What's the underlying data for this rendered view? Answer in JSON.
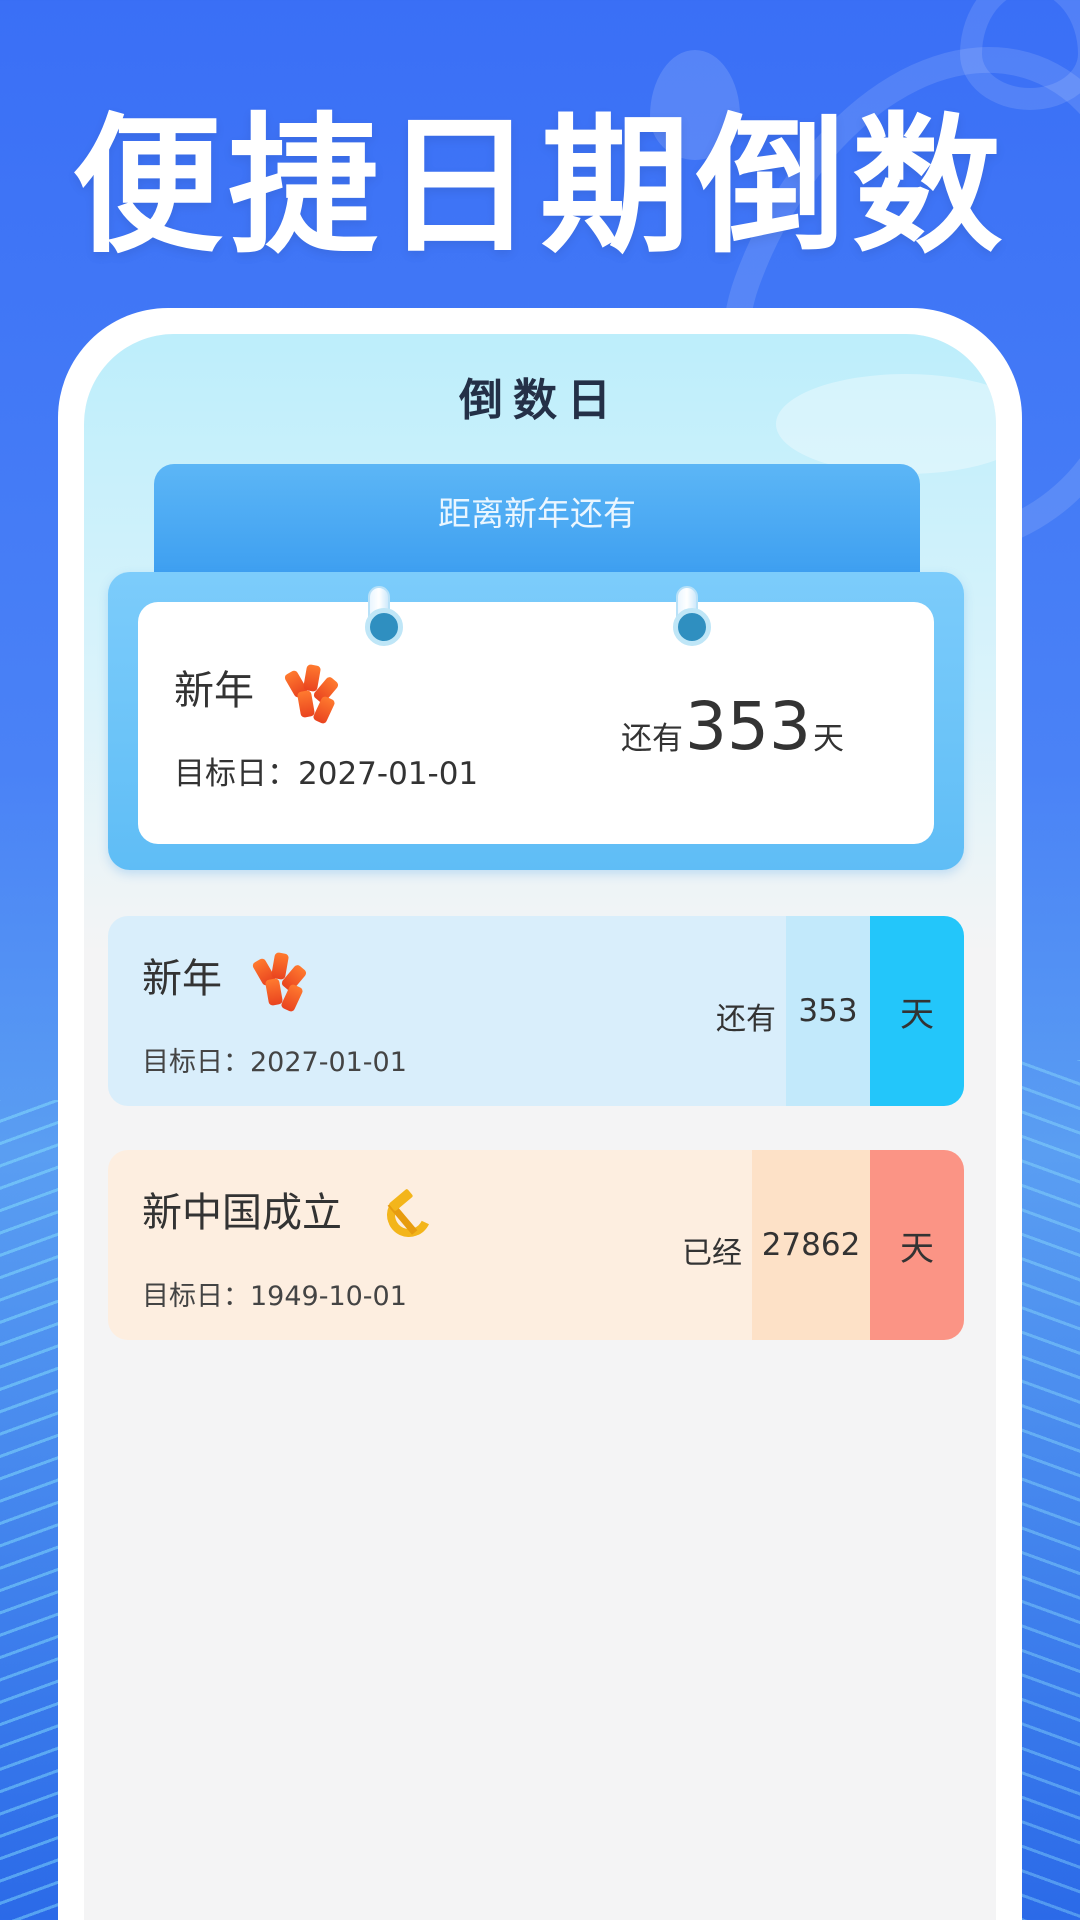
{
  "headline": "便捷日期倒数",
  "app": {
    "nav_title": "倒数日"
  },
  "featured": {
    "tab_label": "距离新年还有",
    "name": "新年",
    "icon": "firecracker-icon",
    "date": "目标日：2027-01-01",
    "prefix": "还有",
    "days": "353",
    "suffix": "天"
  },
  "items": [
    {
      "name": "新年",
      "icon": "firecracker-icon",
      "date": "目标日：2027-01-01",
      "status": "还有",
      "days": "353",
      "unit": "天",
      "color": "#23c6fa"
    },
    {
      "name": "新中国成立",
      "icon": "hammer-sickle-icon",
      "date": "目标日：1949-10-01",
      "status": "已经",
      "days": "27862",
      "unit": "天",
      "color": "#fb9485"
    }
  ]
}
